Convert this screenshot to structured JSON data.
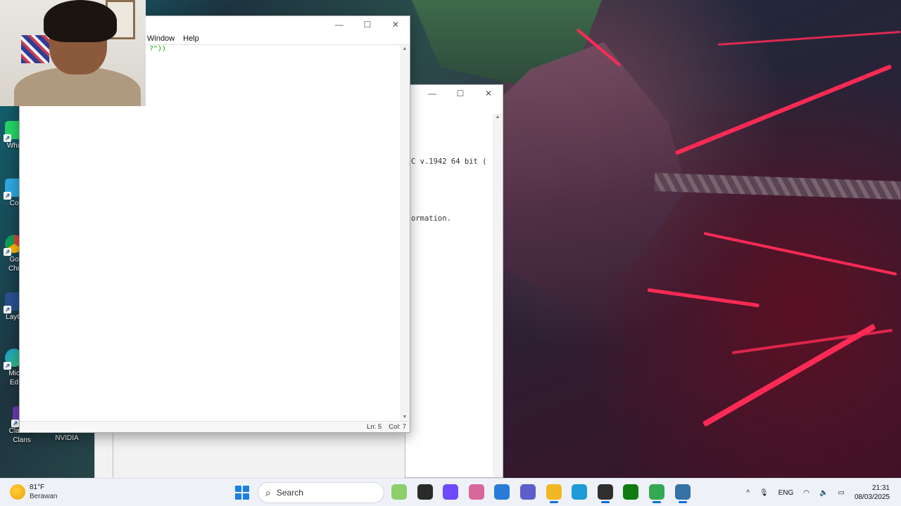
{
  "desktop": {
    "icons": [
      {
        "label": "Wha",
        "icon": "whatsapp-icon",
        "color": "#25d366"
      },
      {
        "label": "Co",
        "icon": "copilot-icon",
        "color": "#2ea7e0"
      },
      {
        "label": "Go\nChr",
        "icon": "chrome-icon",
        "color": "#db4437"
      },
      {
        "label": "LayO",
        "icon": "layout-icon",
        "color": "#2b4f8e"
      },
      {
        "label": "Mic\nEd",
        "icon": "edge-icon",
        "color": "#1c9bd7"
      },
      {
        "label": "Clash of\nClans",
        "icon": "clash-of-clans-icon",
        "color": "#6a3bb5"
      },
      {
        "label": "NVIDIA",
        "icon": "nvidia-icon",
        "color": "#76b900"
      }
    ]
  },
  "editor": {
    "menu": [
      "Window",
      "Help"
    ],
    "code_tail": "?\"))",
    "status": {
      "line": "Ln: 5",
      "col": "Col: 7"
    }
  },
  "shell": {
    "lines": [
      "C v.1942 64 bit (",
      "ormation."
    ]
  },
  "taskbar": {
    "weather": {
      "temp": "81°F",
      "condition": "Berawan"
    },
    "search_label": "Search",
    "apps": [
      {
        "name": "explorer-landscape-icon",
        "color": "#8ccf6b",
        "active": false
      },
      {
        "name": "terminal-icon",
        "color": "#2a2a2a",
        "active": false
      },
      {
        "name": "proton-icon",
        "color": "#6d4aff",
        "active": false
      },
      {
        "name": "copilot-icon",
        "color": "#d8679b",
        "active": false
      },
      {
        "name": "store-icon",
        "color": "#2a7bd8",
        "active": false
      },
      {
        "name": "teams-icon",
        "color": "#5b5fc7",
        "active": false
      },
      {
        "name": "file-explorer-icon",
        "color": "#f2b824",
        "active": true
      },
      {
        "name": "edge-icon",
        "color": "#1c9bd7",
        "active": false
      },
      {
        "name": "obs-icon",
        "color": "#2f2f2f",
        "active": true
      },
      {
        "name": "xbox-icon",
        "color": "#107c10",
        "active": false
      },
      {
        "name": "chrome-icon",
        "color": "#34a853",
        "active": true
      },
      {
        "name": "python-idle-icon",
        "color": "#3572a5",
        "active": true
      }
    ],
    "tray": {
      "chevron": "^",
      "language": "ENG",
      "time": "21:31",
      "date": "08/03/2025"
    }
  }
}
